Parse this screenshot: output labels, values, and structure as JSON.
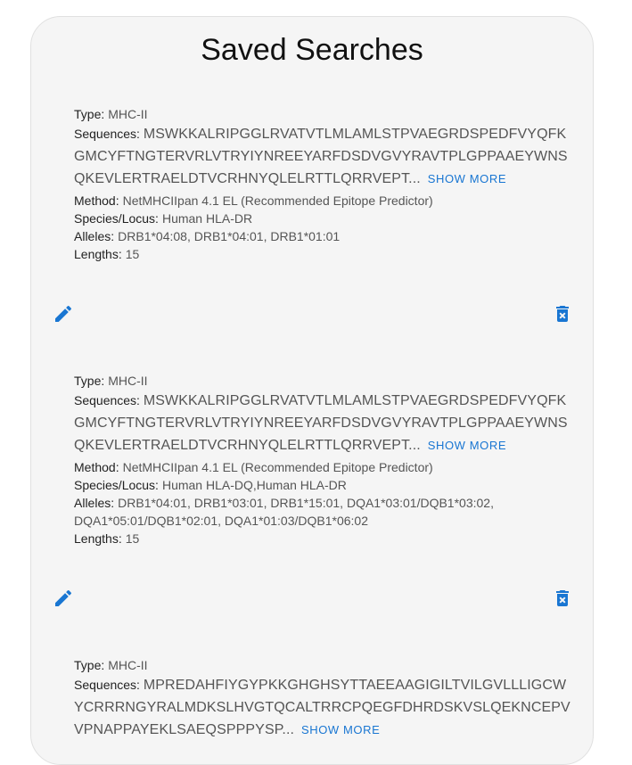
{
  "page": {
    "title": "Saved Searches"
  },
  "labels": {
    "type": "Type:",
    "sequences": "Sequences:",
    "method": "Method:",
    "species": "Species/Locus:",
    "alleles": "Alleles:",
    "lengths": "Lengths:",
    "show_more": "SHOW MORE"
  },
  "colors": {
    "accent": "#1976d2",
    "card_bg": "#f5f5f5"
  },
  "icons": {
    "edit": "pencil-icon",
    "delete": "delete-icon"
  },
  "searches": [
    {
      "type": "MHC-II",
      "sequences": "MSWKKALRIPGGLRVATVTLMLAMLSTPVAEGRDSPEDFVYQFKGMCYFTNGTERVRLVTRYIYNREEYARFDSDVGVYRAVTPLGPPAAEYWNSQKEVLERTRAELDTVCRHNYQLELRTTLQRRVEPT...",
      "method": "NetMHCIIpan 4.1 EL (Recommended Epitope Predictor)",
      "species": "Human HLA-DR",
      "alleles": "DRB1*04:08, DRB1*04:01, DRB1*01:01",
      "lengths": "15"
    },
    {
      "type": "MHC-II",
      "sequences": "MSWKKALRIPGGLRVATVTLMLAMLSTPVAEGRDSPEDFVYQFKGMCYFTNGTERVRLVTRYIYNREEYARFDSDVGVYRAVTPLGPPAAEYWNSQKEVLERTRAELDTVCRHNYQLELRTTLQRRVEPT...",
      "method": "NetMHCIIpan 4.1 EL (Recommended Epitope Predictor)",
      "species": "Human HLA-DQ,Human HLA-DR",
      "alleles": "DRB1*04:01, DRB1*03:01, DRB1*15:01, DQA1*03:01/DQB1*03:02, DQA1*05:01/DQB1*02:01, DQA1*01:03/DQB1*06:02",
      "lengths": "15"
    },
    {
      "type": "MHC-II",
      "sequences": "MPREDAHFIYGYPKKGHGHSYTTAEEAAGIGILTVILGVLLLIGCWYCRRRNGYRALMDKSLHVGTQCALTRRCPQEGFDHRDSKVSLQEKNCEPVVPNAPPAYEKLSAEQSPPPYSP..."
    }
  ]
}
